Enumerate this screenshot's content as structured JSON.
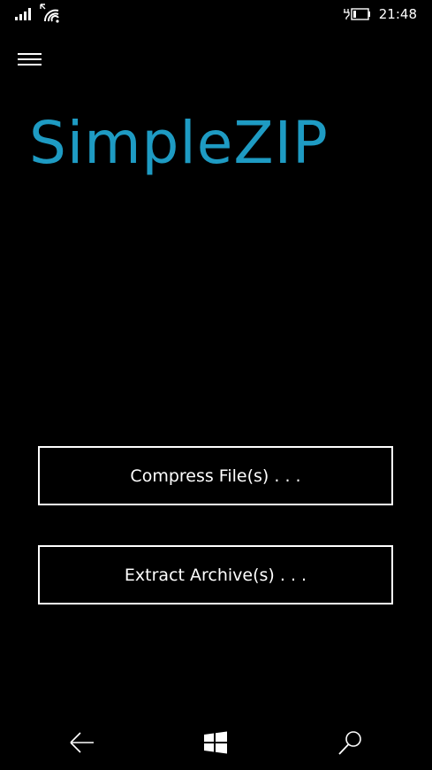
{
  "status_bar": {
    "time": "21:48",
    "icons": [
      "signal-icon",
      "wifi-icon",
      "battery-charging-icon"
    ]
  },
  "menu": {
    "icon": "hamburger-icon"
  },
  "app": {
    "title": "SimpleZIP",
    "accent_color": "#1e9bc3"
  },
  "actions": {
    "compress_label": "Compress File(s) . . .",
    "extract_label": "Extract Archive(s) . . ."
  },
  "nav_bar": {
    "icons": [
      "back-arrow-icon",
      "windows-start-icon",
      "search-icon"
    ]
  }
}
